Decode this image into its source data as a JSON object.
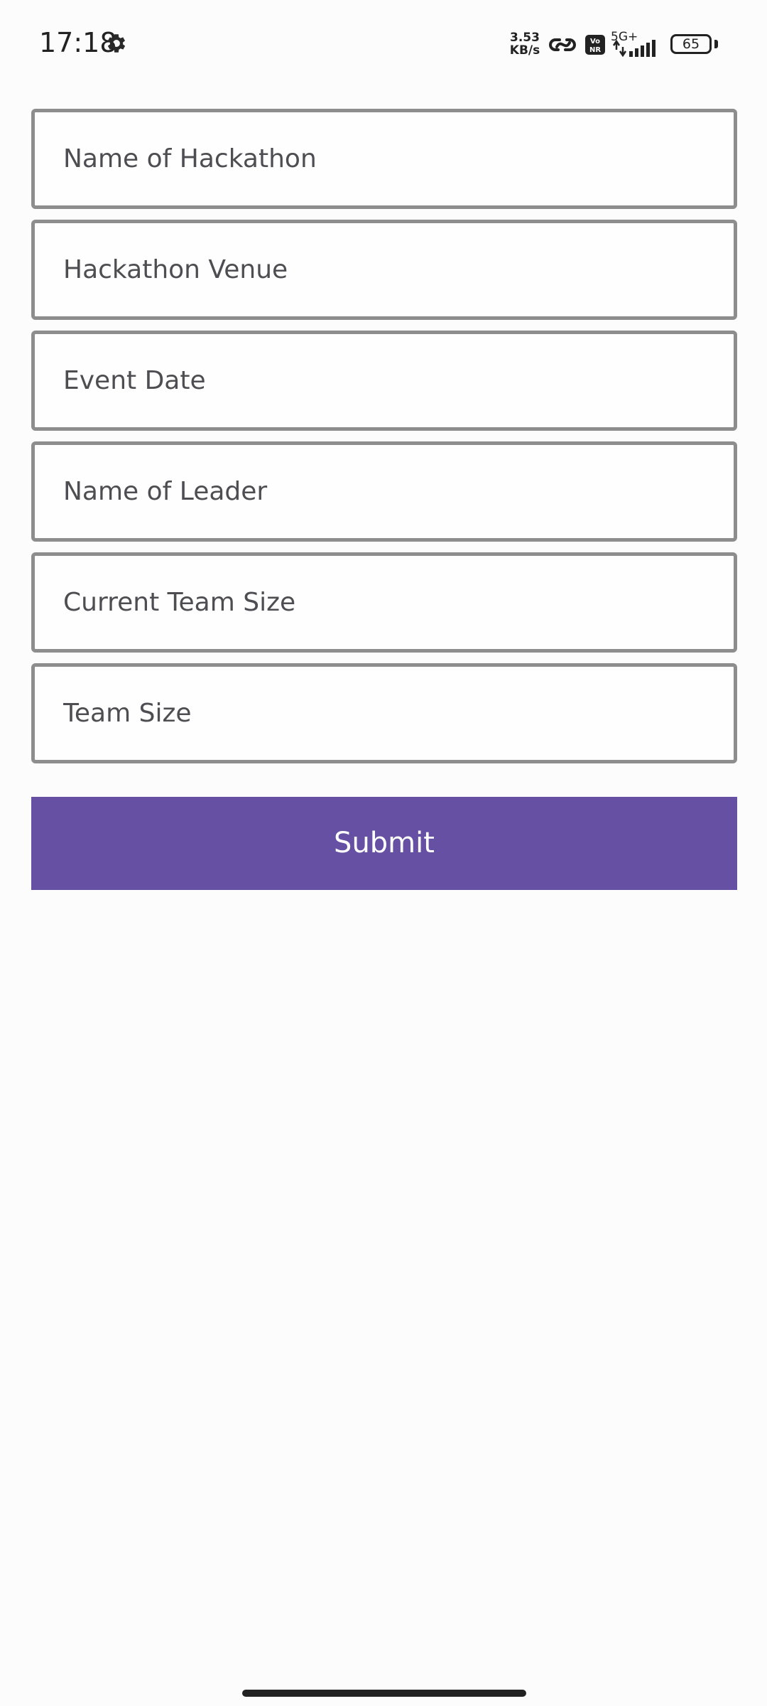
{
  "status_bar": {
    "time": "17:18",
    "net_speed_value": "3.53",
    "net_speed_unit": "KB/s",
    "network_type": "5G+",
    "battery_level": "65",
    "icons": [
      "gear-icon",
      "link-icon",
      "volte-icon",
      "signal-icon",
      "battery-icon"
    ]
  },
  "form": {
    "fields": [
      {
        "placeholder": "Name of Hackathon",
        "value": ""
      },
      {
        "placeholder": "Hackathon Venue",
        "value": ""
      },
      {
        "placeholder": "Event Date",
        "value": ""
      },
      {
        "placeholder": "Name of Leader",
        "value": ""
      },
      {
        "placeholder": "Current Team Size",
        "value": ""
      },
      {
        "placeholder": "Team Size",
        "value": ""
      }
    ],
    "submit_label": "Submit"
  },
  "colors": {
    "accent": "#6650a4",
    "field_border": "#8d8d8d",
    "background": "#fdfcfd"
  }
}
